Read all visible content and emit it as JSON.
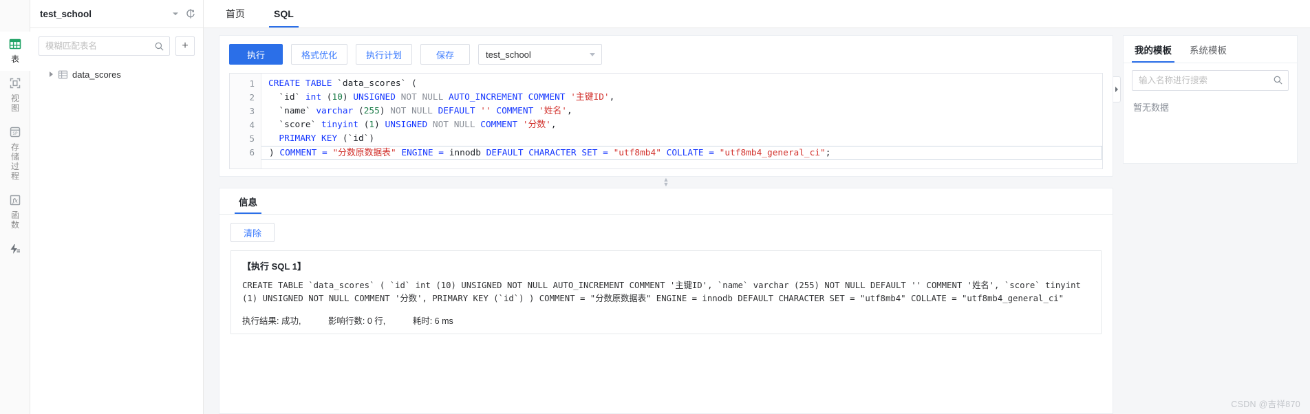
{
  "rail": {
    "items": [
      {
        "label": "表",
        "icon": "table-icon",
        "active": true
      },
      {
        "label": "视图",
        "icon": "view-icon",
        "active": false
      },
      {
        "label": "存储过程",
        "icon": "stored-procedure-icon",
        "active": false
      },
      {
        "label": "函数",
        "icon": "function-icon",
        "active": false
      },
      {
        "label": "",
        "icon": "trigger-icon",
        "active": false
      }
    ]
  },
  "sidebar": {
    "database_name": "test_school",
    "dropdown_icon": "chevron-down-icon",
    "refresh_icon": "refresh-icon",
    "search": {
      "placeholder": "模糊匹配表名",
      "value": "",
      "icon": "search-icon"
    },
    "add_button_label": "+",
    "tree": [
      {
        "label": "data_scores",
        "icon": "table-icon",
        "expanded": false
      }
    ]
  },
  "tabs": [
    {
      "label": "首页",
      "active": false
    },
    {
      "label": "SQL",
      "active": true
    }
  ],
  "toolbar": {
    "execute_label": "执行",
    "format_label": "格式优化",
    "explain_label": "执行计划",
    "save_label": "保存",
    "schema_select_value": "test_school"
  },
  "editor": {
    "lines": [
      {
        "no": "1",
        "current": false,
        "tokens": [
          {
            "t": "CREATE TABLE ",
            "c": "kw"
          },
          {
            "t": "`data_scores` (",
            "c": "pln"
          }
        ]
      },
      {
        "no": "2",
        "current": false,
        "tokens": [
          {
            "t": "  `id` ",
            "c": "pln"
          },
          {
            "t": "int ",
            "c": "typ"
          },
          {
            "t": "(",
            "c": "pln"
          },
          {
            "t": "10",
            "c": "num"
          },
          {
            "t": ") ",
            "c": "pln"
          },
          {
            "t": "UNSIGNED ",
            "c": "kw"
          },
          {
            "t": "NOT NULL ",
            "c": "gry"
          },
          {
            "t": "AUTO_INCREMENT COMMENT ",
            "c": "kw"
          },
          {
            "t": "'主键ID'",
            "c": "str"
          },
          {
            "t": ",",
            "c": "pln"
          }
        ]
      },
      {
        "no": "3",
        "current": false,
        "tokens": [
          {
            "t": "  `name` ",
            "c": "pln"
          },
          {
            "t": "varchar ",
            "c": "typ"
          },
          {
            "t": "(",
            "c": "pln"
          },
          {
            "t": "255",
            "c": "num"
          },
          {
            "t": ") ",
            "c": "pln"
          },
          {
            "t": "NOT NULL ",
            "c": "gry"
          },
          {
            "t": "DEFAULT ",
            "c": "kw"
          },
          {
            "t": "''",
            "c": "str"
          },
          {
            "t": " COMMENT ",
            "c": "kw"
          },
          {
            "t": "'姓名'",
            "c": "str"
          },
          {
            "t": ",",
            "c": "pln"
          }
        ]
      },
      {
        "no": "4",
        "current": false,
        "tokens": [
          {
            "t": "  `score` ",
            "c": "pln"
          },
          {
            "t": "tinyint ",
            "c": "typ"
          },
          {
            "t": "(",
            "c": "pln"
          },
          {
            "t": "1",
            "c": "num"
          },
          {
            "t": ") ",
            "c": "pln"
          },
          {
            "t": "UNSIGNED ",
            "c": "kw"
          },
          {
            "t": "NOT NULL ",
            "c": "gry"
          },
          {
            "t": "COMMENT ",
            "c": "kw"
          },
          {
            "t": "'分数'",
            "c": "str"
          },
          {
            "t": ",",
            "c": "pln"
          }
        ]
      },
      {
        "no": "5",
        "current": false,
        "tokens": [
          {
            "t": "  PRIMARY KEY ",
            "c": "kw"
          },
          {
            "t": "(`id`)",
            "c": "pln"
          }
        ]
      },
      {
        "no": "6",
        "current": true,
        "tokens": [
          {
            "t": ") ",
            "c": "pln"
          },
          {
            "t": "COMMENT = ",
            "c": "kw"
          },
          {
            "t": "\"分数原数据表\"",
            "c": "str"
          },
          {
            "t": " ENGINE = ",
            "c": "kw"
          },
          {
            "t": "innodb ",
            "c": "pln"
          },
          {
            "t": "DEFAULT CHARACTER SET = ",
            "c": "kw"
          },
          {
            "t": "\"utf8mb4\"",
            "c": "str"
          },
          {
            "t": " COLLATE = ",
            "c": "kw"
          },
          {
            "t": "\"utf8mb4_general_ci\"",
            "c": "str"
          },
          {
            "t": ";",
            "c": "pln"
          }
        ]
      }
    ]
  },
  "info": {
    "tab_label": "信息",
    "clear_label": "清除",
    "log_title": "【执行 SQL 1】",
    "log_sql": "CREATE TABLE `data_scores` ( `id` int (10) UNSIGNED NOT NULL AUTO_INCREMENT COMMENT '主键ID', `name` varchar (255) NOT NULL DEFAULT '' COMMENT '姓名', `score` tinyint (1) UNSIGNED NOT NULL COMMENT '分数', PRIMARY KEY (`id`) ) COMMENT = \"分数原数据表\" ENGINE = innodb DEFAULT CHARACTER SET = \"utf8mb4\" COLLATE = \"utf8mb4_general_ci\"",
    "result_label": "执行结果: 成功,",
    "rows_label": "影响行数: 0 行,",
    "time_label": "耗时: 6 ms"
  },
  "templates": {
    "tabs": [
      {
        "label": "我的模板",
        "active": true
      },
      {
        "label": "系统模板",
        "active": false
      }
    ],
    "search": {
      "placeholder": "输入名称进行搜索",
      "value": "",
      "icon": "search-icon"
    },
    "empty_text": "暂无数据",
    "collapse_icon": "chevron-right-icon"
  },
  "watermark": "CSDN @吉祥870",
  "colors": {
    "accent": "#2b6fe8",
    "link": "#3a7afe",
    "string": "#d2322d",
    "keyword": "#1436ff"
  }
}
